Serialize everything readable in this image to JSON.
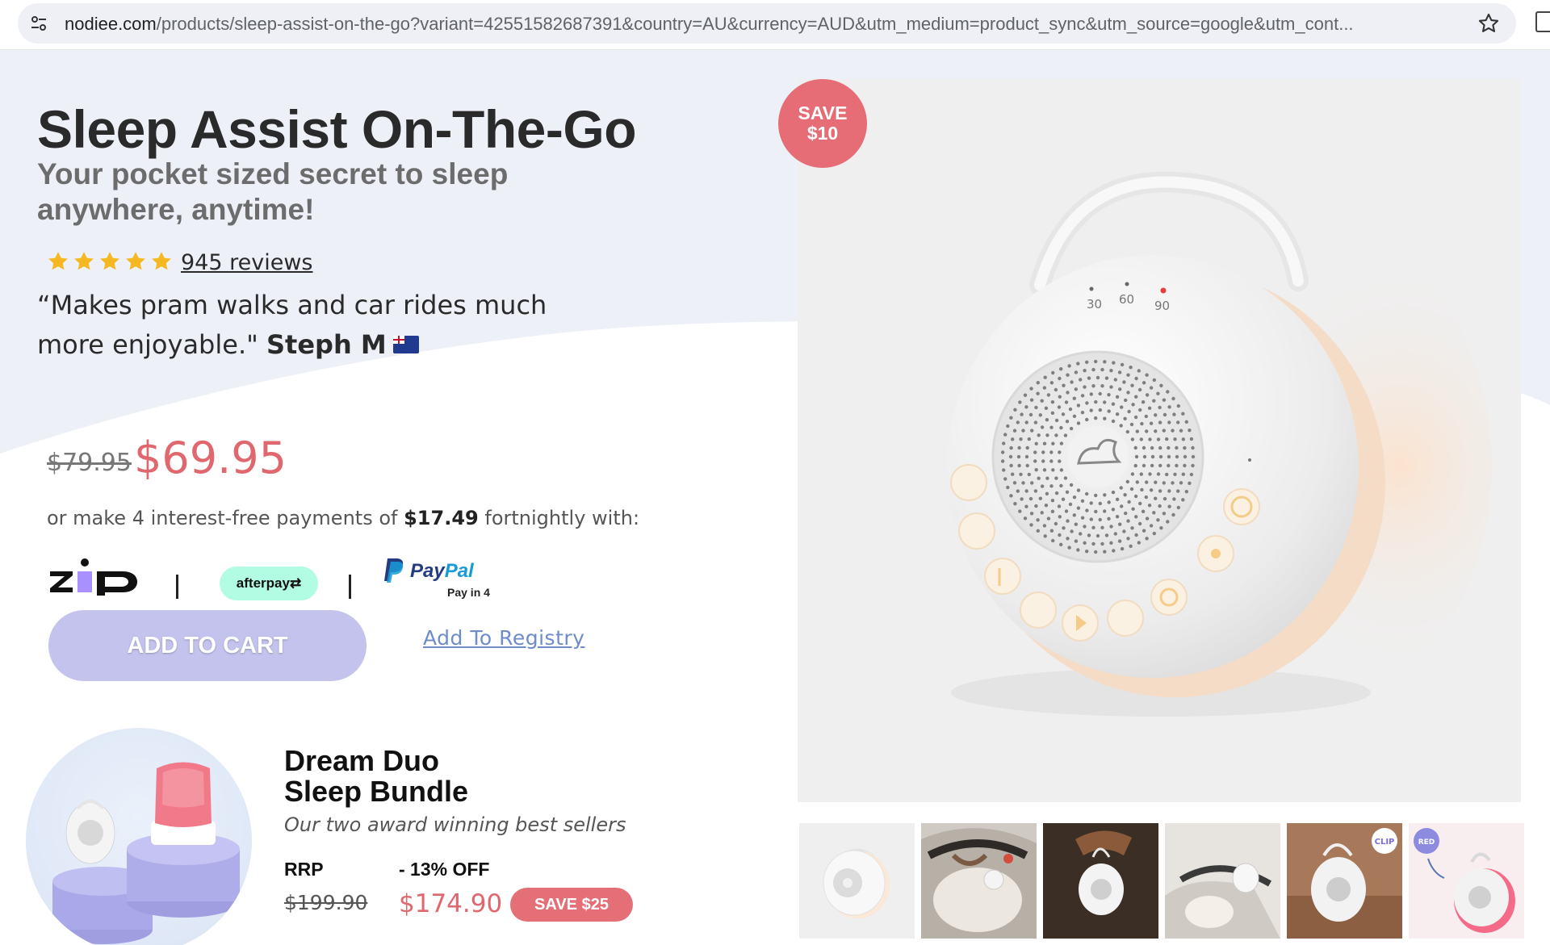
{
  "browser": {
    "url_host": "nodiee.com",
    "url_rest": "/products/sleep-assist-on-the-go?variant=42551582687391&country=AU&currency=AUD&utm_medium=product_sync&utm_source=google&utm_cont..."
  },
  "product": {
    "title": "Sleep Assist On-The-Go",
    "subtitle": "Your pocket sized secret to sleep anywhere, anytime!",
    "rating": 5,
    "reviews_label": "945 reviews",
    "quote_text": "“Makes pram walks and car rides much more enjoyable.\"",
    "quote_author": "Steph M",
    "old_price": "$79.95",
    "price": "$69.95",
    "installments_prefix": "or make 4 interest-free payments of",
    "installments_amount": "$17.49",
    "installments_suffix": "fortnightly with:",
    "payment_logos": {
      "afterpay": "afterpay",
      "paypal_pay": "Pay",
      "paypal_pal": "Pal",
      "paypal_sub": "Pay in 4"
    },
    "add_to_cart_label": "ADD TO CART",
    "registry_label": "Add To Registry"
  },
  "bundle": {
    "title_line1": "Dream Duo",
    "title_line2": "Sleep Bundle",
    "subtitle": "Our two award winning best sellers",
    "rrp_label": "RRP",
    "rrp_value": "$199.90",
    "off_label": "- 13% OFF",
    "price": "$174.90",
    "save_label": "SAVE $25"
  },
  "gallery": {
    "save_badge_line1": "SAVE",
    "save_badge_line2": "$10",
    "timer_labels": [
      "30",
      "60",
      "90"
    ],
    "thumb_clip_badge": "CLIP",
    "thumb_red_badge": "RED"
  },
  "colors": {
    "accent_price": "#e0676d",
    "button": "#c3c3ee",
    "badge": "#e66d75",
    "afterpay_mint": "#b2fce4",
    "paypal_blue": "#253b80",
    "page_tint": "#eef0f8"
  },
  "icons": [
    "site-settings-icon",
    "bookmark-star-icon",
    "star-icon",
    "australia-flag-icon",
    "zip-logo",
    "afterpay-logo",
    "paypal-logo"
  ]
}
